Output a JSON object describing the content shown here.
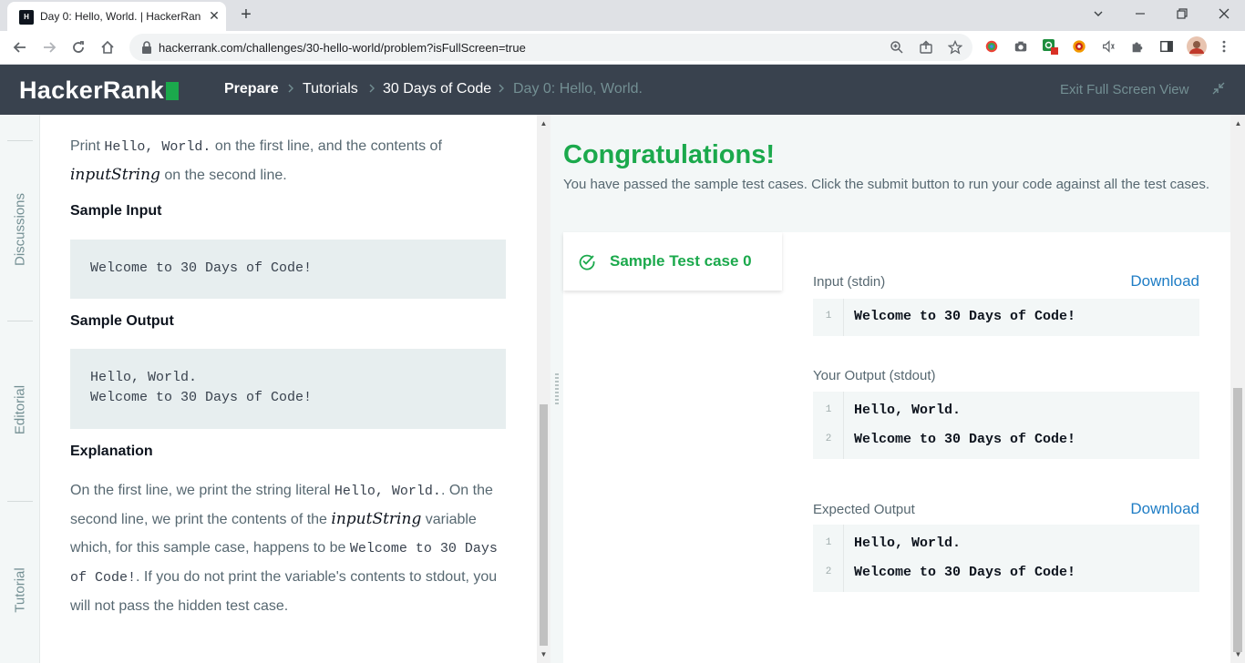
{
  "browser": {
    "tab_title": "Day 0: Hello, World. | HackerRank",
    "tab_favicon_text": "H",
    "url": "hackerrank.com/challenges/30-hello-world/problem?isFullScreen=true"
  },
  "header": {
    "logo": "HackerRank",
    "breadcrumbs": [
      "Prepare",
      "Tutorials",
      "30 Days of Code",
      "Day 0: Hello, World."
    ],
    "exit_fullscreen": "Exit Full Screen View"
  },
  "sidebar": {
    "items": [
      {
        "label": "Discussions"
      },
      {
        "label": "Editorial"
      },
      {
        "label": "Tutorial"
      }
    ]
  },
  "problem": {
    "output_intro_prefix": "Print",
    "output_intro_code": "Hello, World.",
    "output_intro_mid": "on the first line, and the contents of",
    "output_var": "inputString",
    "output_intro_suffix": "on the second line.",
    "sample_input_heading": "Sample Input",
    "sample_input": [
      "Welcome to 30 Days of Code!"
    ],
    "sample_output_heading": "Sample Output",
    "sample_output": [
      "Hello, World.",
      "Welcome to 30 Days of Code!"
    ],
    "explanation_heading": "Explanation",
    "exp_1": "On the first line, we print the string literal",
    "exp_code1": "Hello, World.",
    "exp_2": ". On the",
    "exp_3": "second line, we print the contents of the",
    "exp_var": "inputString",
    "exp_4": "variable",
    "exp_5": "which, for this sample case, happens to be",
    "exp_code2a": "Welcome to 30 Days",
    "exp_code2b": "of Code!",
    "exp_6": ". If you do not print the variable's contents to stdout, you",
    "exp_7": "will not pass the hidden test case."
  },
  "results": {
    "title": "Congratulations!",
    "subtitle": "You have passed the sample test cases. Click the submit button to run your code against all the test cases.",
    "test_case_label": "Sample Test case 0",
    "input_label": "Input (stdin)",
    "download_label": "Download",
    "input_lines": [
      {
        "num": "1",
        "text": "Welcome to 30 Days of Code!"
      }
    ],
    "your_output_label": "Your Output (stdout)",
    "your_output_lines": [
      {
        "num": "1",
        "text": "Hello, World."
      },
      {
        "num": "2",
        "text": "Welcome to 30 Days of Code!"
      }
    ],
    "expected_label": "Expected Output",
    "expected_lines": [
      {
        "num": "1",
        "text": "Hello, World."
      },
      {
        "num": "2",
        "text": "Welcome to 30 Days of Code!"
      }
    ]
  },
  "colors": {
    "brand_green": "#1ba94c",
    "header_bg": "#39424e",
    "link_blue": "#1f7dc5"
  }
}
